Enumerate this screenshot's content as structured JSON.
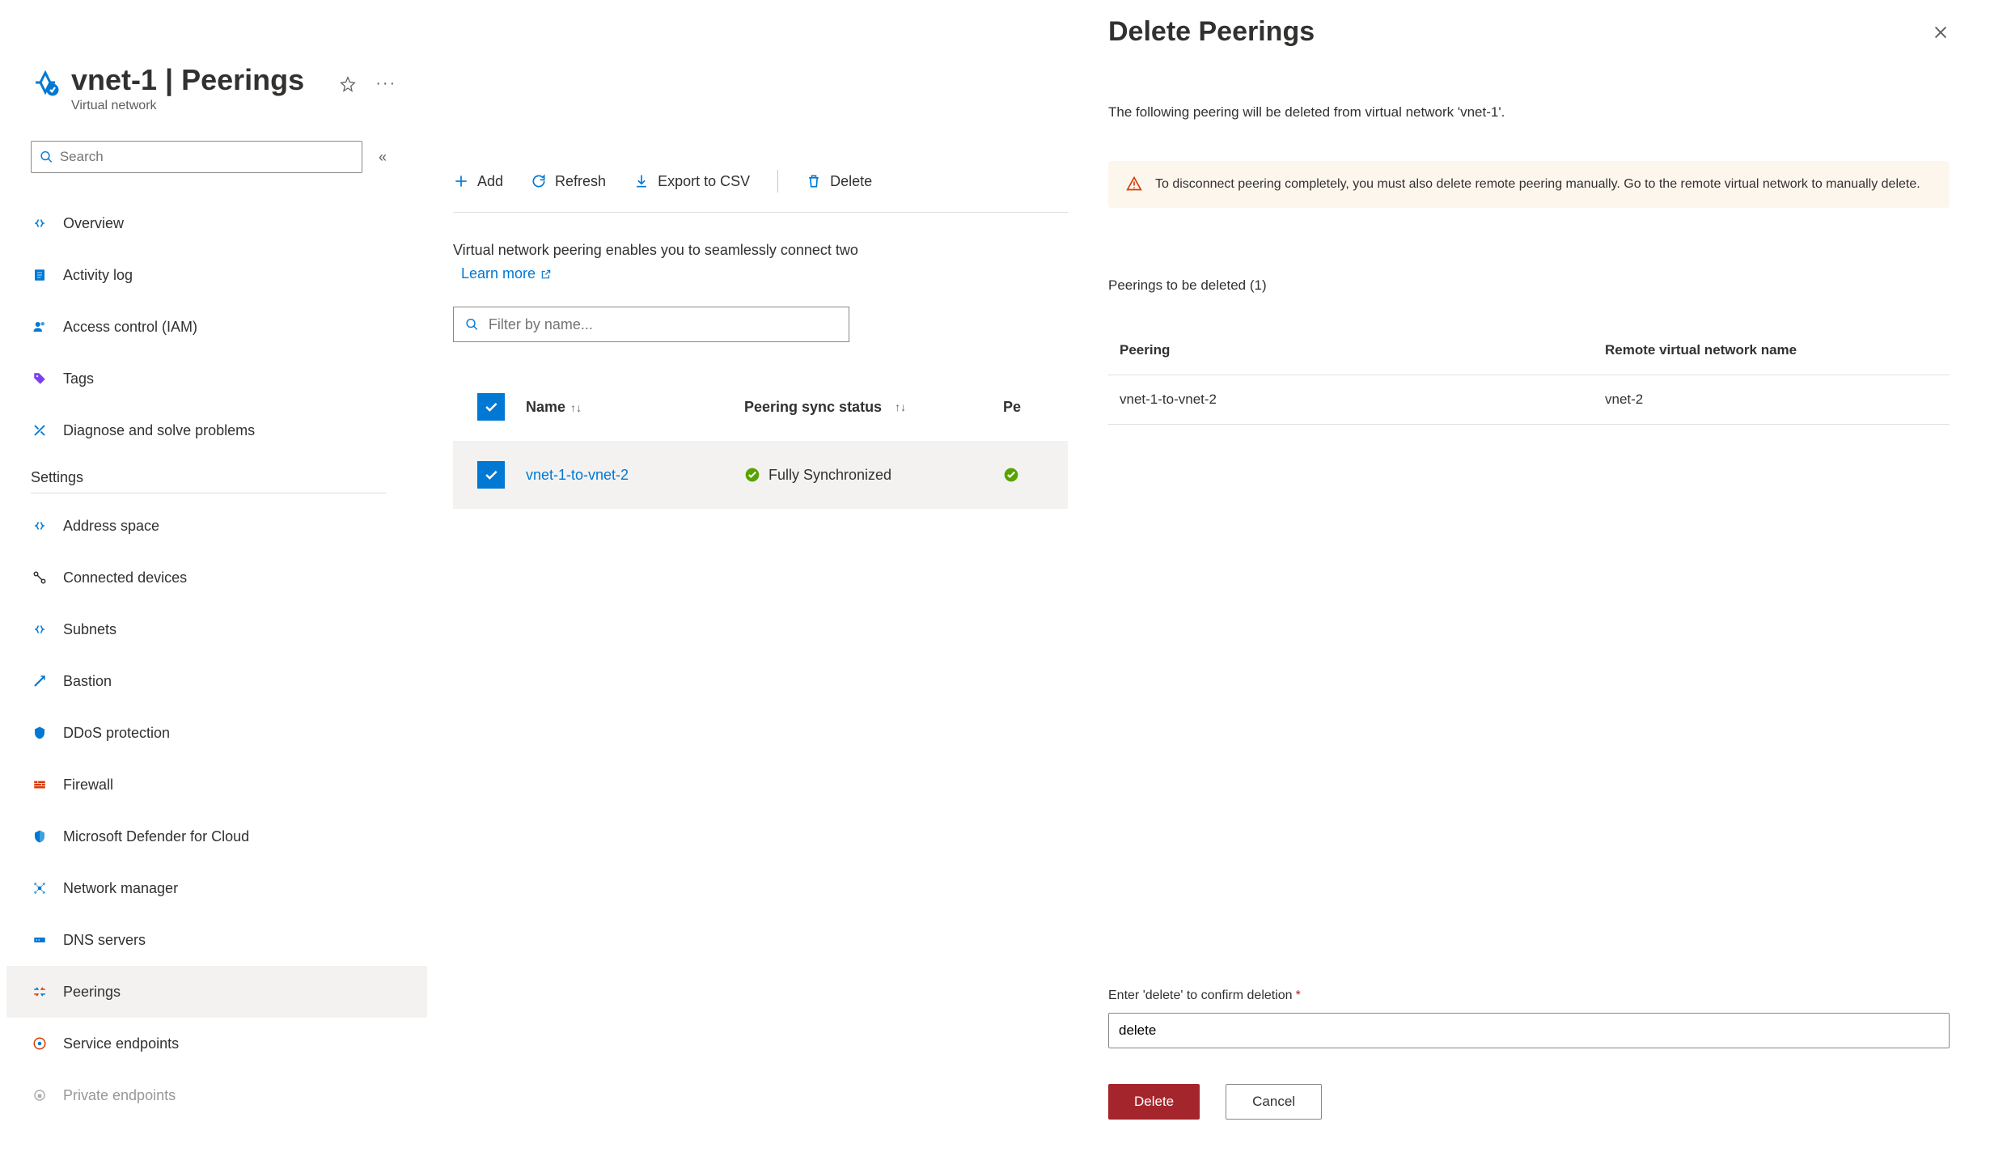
{
  "header": {
    "title": "vnet-1 | Peerings",
    "subtitle": "Virtual network"
  },
  "sidebar": {
    "search_placeholder": "Search",
    "top_items": [
      {
        "label": "Overview",
        "icon": "overview"
      },
      {
        "label": "Activity log",
        "icon": "activity-log"
      },
      {
        "label": "Access control (IAM)",
        "icon": "access-control"
      },
      {
        "label": "Tags",
        "icon": "tags"
      },
      {
        "label": "Diagnose and solve problems",
        "icon": "diagnose"
      }
    ],
    "settings_label": "Settings",
    "settings_items": [
      {
        "label": "Address space",
        "icon": "address-space"
      },
      {
        "label": "Connected devices",
        "icon": "connected-devices"
      },
      {
        "label": "Subnets",
        "icon": "subnets"
      },
      {
        "label": "Bastion",
        "icon": "bastion"
      },
      {
        "label": "DDoS protection",
        "icon": "ddos"
      },
      {
        "label": "Firewall",
        "icon": "firewall"
      },
      {
        "label": "Microsoft Defender for Cloud",
        "icon": "defender"
      },
      {
        "label": "Network manager",
        "icon": "network-manager"
      },
      {
        "label": "DNS servers",
        "icon": "dns"
      },
      {
        "label": "Peerings",
        "icon": "peerings",
        "active": true
      },
      {
        "label": "Service endpoints",
        "icon": "service-endpoints"
      },
      {
        "label": "Private endpoints",
        "icon": "private-endpoints"
      }
    ]
  },
  "toolbar": {
    "add": "Add",
    "refresh": "Refresh",
    "export": "Export to CSV",
    "delete": "Delete"
  },
  "main": {
    "description": "Virtual network peering enables you to seamlessly connect two",
    "learn_more": "Learn more",
    "filter_placeholder": "Filter by name...",
    "columns": {
      "name": "Name",
      "sync": "Peering sync status",
      "status_prefix": "Pe"
    },
    "rows": [
      {
        "name": "vnet-1-to-vnet-2",
        "sync": "Fully Synchronized"
      }
    ]
  },
  "panel": {
    "title": "Delete Peerings",
    "description": "The following peering will be deleted from virtual network 'vnet-1'.",
    "warning": "To disconnect peering completely, you must also delete remote peering manually. Go to the remote virtual network to manually delete.",
    "section_label": "Peerings to be deleted (1)",
    "columns": {
      "peering": "Peering",
      "remote": "Remote virtual network name"
    },
    "rows": [
      {
        "peering": "vnet-1-to-vnet-2",
        "remote": "vnet-2"
      }
    ],
    "confirm_label": "Enter 'delete' to confirm deletion",
    "confirm_value": "delete",
    "delete_btn": "Delete",
    "cancel_btn": "Cancel"
  }
}
